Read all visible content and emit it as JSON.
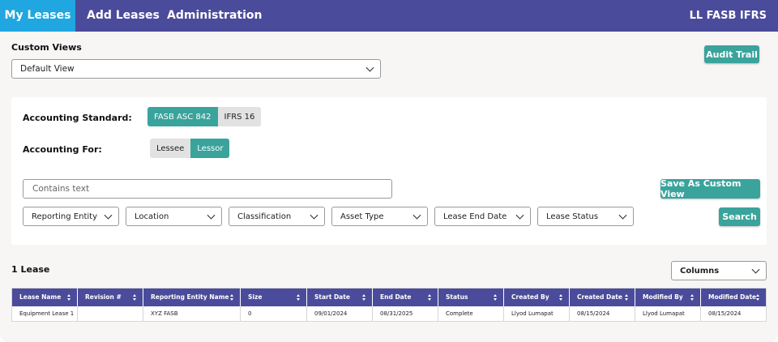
{
  "nav": {
    "tabs": [
      "My Leases",
      "Add Leases",
      "Administration"
    ],
    "brand": "LL FASB IFRS",
    "active_color": "#20a6e0",
    "bar_color": "#4b4b9b"
  },
  "custom_views": {
    "label": "Custom Views",
    "selected": "Default View",
    "audit_trail": "Audit Trail"
  },
  "filters": {
    "accounting_standard_label": "Accounting Standard:",
    "standards": [
      {
        "label": "FASB ASC 842",
        "selected": true
      },
      {
        "label": "IFRS 16",
        "selected": false
      }
    ],
    "accounting_for_label": "Accounting For:",
    "accounting_for": [
      {
        "label": "Lessee",
        "selected": false
      },
      {
        "label": "Lessor",
        "selected": true
      }
    ],
    "search_placeholder": "Contains text",
    "save_custom_view": "Save As Custom View",
    "search_button": "Search",
    "dropdowns": [
      "Reporting Entity",
      "Location",
      "Classification",
      "Asset Type",
      "Lease End Date",
      "Lease Status"
    ]
  },
  "results": {
    "count_label": "1 Lease",
    "columns_button": "Columns"
  },
  "table": {
    "headers": [
      "Lease Name",
      "Revision #",
      "Reporting Entity Name",
      "Size",
      "Start Date",
      "End Date",
      "Status",
      "Created By",
      "Created Date",
      "Modified By",
      "Modified Date"
    ],
    "rows": [
      [
        "Equipment Lease 1",
        "",
        "XYZ FASB",
        "0",
        "09/01/2024",
        "08/31/2025",
        "Complete",
        "Llyod Lumapat",
        "08/15/2024",
        "Llyod Lumapat",
        "08/15/2024"
      ]
    ]
  },
  "accent_color": "#3aa39c"
}
